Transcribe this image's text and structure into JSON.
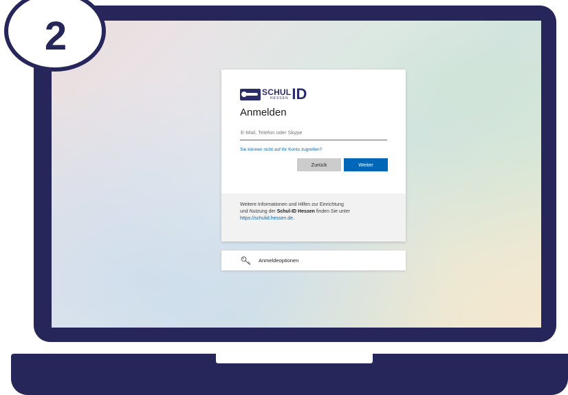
{
  "step": {
    "number": "2"
  },
  "login": {
    "brand": {
      "schul": "SCHUL",
      "hessen": "HESSEN",
      "id": "ID"
    },
    "title": "Anmelden",
    "email_placeholder": "E-Mail, Telefon oder Skype",
    "help_link": "Sie können nicht auf Ihr Konto zugreifen?",
    "back_label": "Zurück",
    "next_label": "Weiter",
    "info": {
      "line1": "Weitere Informationen und Hilfen zur Einrichtung",
      "line2_prefix": "und Nutzung der ",
      "line2_bold": "Schul-ID Hessen",
      "line2_suffix": " finden Sie unter",
      "url": "https://schulid.hessen.de",
      "url_suffix": "."
    }
  },
  "options": {
    "label": "Anmeldeoptionen",
    "icon": "key-icon"
  },
  "colors": {
    "frame": "#27265a",
    "accent": "#0067b8",
    "button_secondary": "#cccccc",
    "info_bg": "#f2f2f2"
  }
}
